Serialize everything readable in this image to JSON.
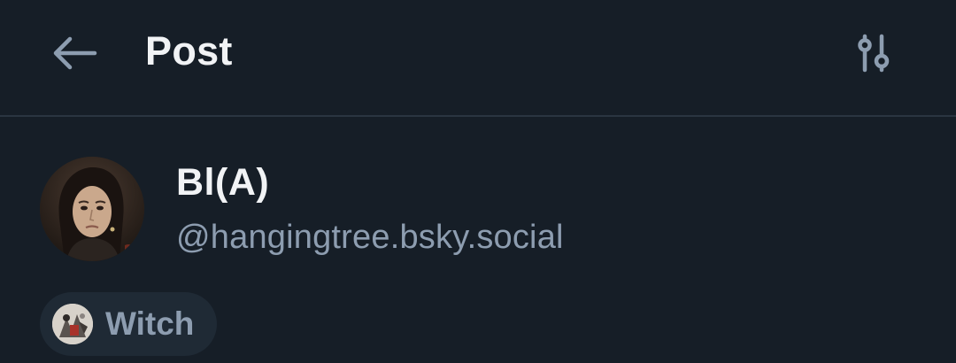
{
  "header": {
    "title": "Post",
    "back_icon": "arrow-left-icon",
    "settings_icon": "sliders-icon"
  },
  "author": {
    "display_name": "Bl(A)",
    "handle": "@hangingtree.bsky.social",
    "avatar_icon": "avatar-portrait"
  },
  "label_pill": {
    "text": "Witch",
    "icon": "labeler-avatar-icon"
  },
  "colors": {
    "background": "#161e27",
    "primary_text": "#f1f3f5",
    "secondary_text": "#8d9db0",
    "pill_background": "#1f2a35",
    "divider": "#2a3541"
  }
}
